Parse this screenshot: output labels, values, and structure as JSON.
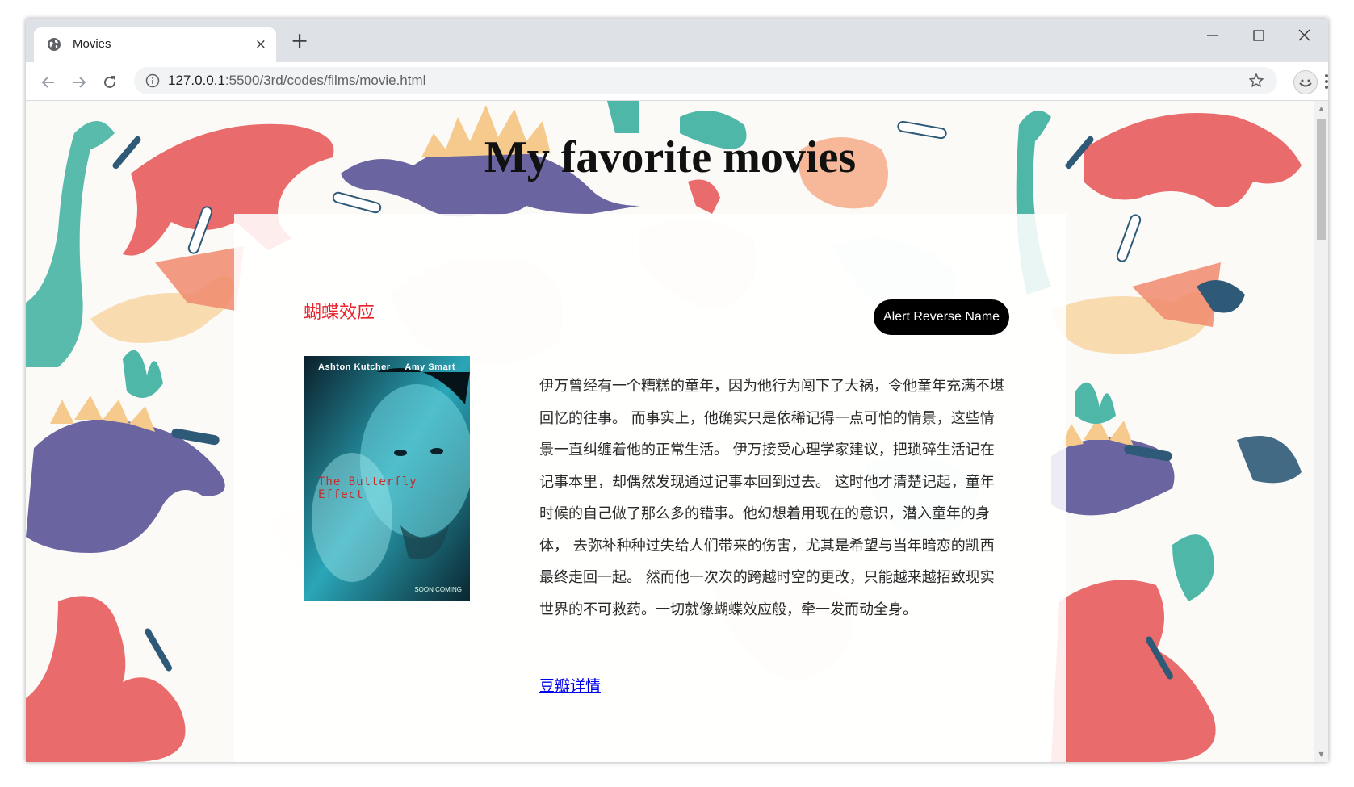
{
  "browser": {
    "tab_title": "Movies",
    "tab_close": "×",
    "new_tab": "+",
    "url_host": "127.0.0.1",
    "url_path": ":5500/3rd/codes/films/movie.html"
  },
  "page": {
    "title": "My favorite movies",
    "movie_name": "蝴蝶效应",
    "alert_button_label": "Alert Reverse Name",
    "poster": {
      "actor_left": "Ashton Kutcher",
      "actor_right": "Amy Smart",
      "title": "The Butterfly Effect",
      "tagline_bottom": "SOON COMING"
    },
    "synopsis": "伊万曾经有一个糟糕的童年，因为他行为闯下了大祸，令他童年充满不堪回忆的往事。 而事实上，他确实只是依稀记得一点可怕的情景，这些情景一直纠缠着他的正常生活。 伊万接受心理学家建议，把琐碎生活记在记事本里，却偶然发现通过记事本回到过去。 这时他才清楚记起，童年时候的自己做了那么多的错事。他幻想着用现在的意识，潜入童年的身体， 去弥补种种过失给人们带来的伤害，尤其是希望与当年暗恋的凯西最终走回一起。 然而他一次次的跨越时空的更改，只能越来越招致现实世界的不可救药。一切就像蝴蝶效应般，牵一发而动全身。",
    "douban_link": "豆瓣详情"
  },
  "colors": {
    "title_bar": "#dee1e6",
    "movie_name": "#e8212b",
    "button_bg": "#000000",
    "link": "#0000ee",
    "dino_red": "#ea6b6b",
    "dino_purple": "#6a64a0",
    "dino_teal": "#4fb7a7",
    "dino_peach": "#f6b899",
    "dino_navy": "#2e5a78"
  },
  "icons": [
    "globe-icon",
    "close-icon",
    "plus-icon",
    "minimize-icon",
    "maximize-icon",
    "window-close-icon",
    "back-arrow-icon",
    "forward-arrow-icon",
    "reload-icon",
    "info-icon",
    "star-icon",
    "profile-avatar",
    "kebab-menu-icon"
  ]
}
